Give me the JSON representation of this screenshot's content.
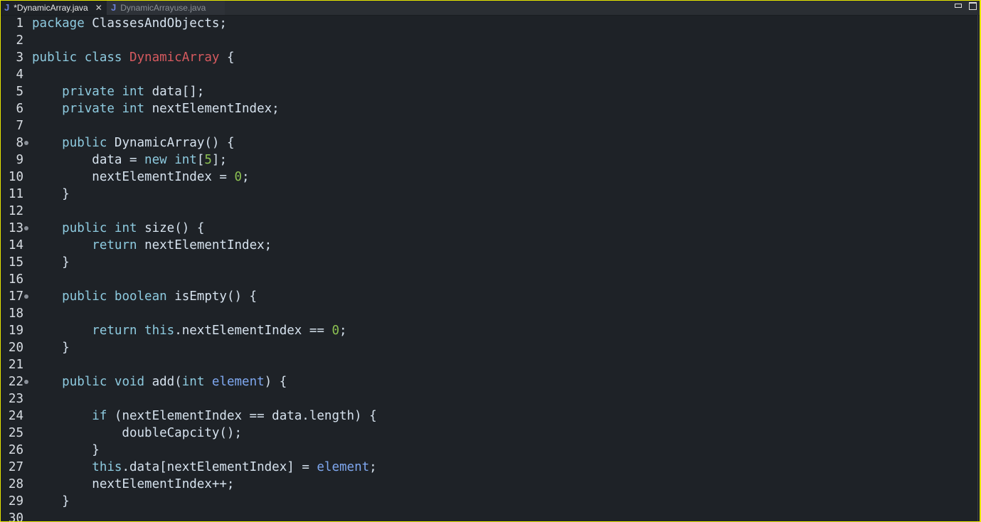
{
  "tabs": [
    {
      "label": "*DynamicArray.java",
      "icon": "java-file-icon",
      "active": true
    },
    {
      "label": "DynamicArrayuse.java",
      "icon": "java-file-icon",
      "active": false
    }
  ],
  "colors": {
    "keyword": "#8ecbe0",
    "class": "#d65a5f",
    "number": "#8cc152",
    "param": "#7fa8f0",
    "text": "#d6e2ee",
    "background": "#1e2227"
  },
  "lines": [
    {
      "n": "1",
      "seg": [
        [
          "kw",
          "package "
        ],
        [
          "plain",
          "ClassesAndObjects;"
        ]
      ]
    },
    {
      "n": "2",
      "seg": []
    },
    {
      "n": "3",
      "seg": [
        [
          "kw",
          "public class "
        ],
        [
          "cls",
          "DynamicArray"
        ],
        [
          "plain",
          " {"
        ]
      ]
    },
    {
      "n": "4",
      "seg": []
    },
    {
      "n": "5",
      "seg": [
        [
          "plain",
          "    "
        ],
        [
          "kw",
          "private int "
        ],
        [
          "plain",
          "data[];"
        ]
      ]
    },
    {
      "n": "6",
      "seg": [
        [
          "plain",
          "    "
        ],
        [
          "kw",
          "private int "
        ],
        [
          "plain",
          "nextElementIndex;"
        ]
      ]
    },
    {
      "n": "7",
      "seg": []
    },
    {
      "n": "8",
      "fold": true,
      "seg": [
        [
          "plain",
          "    "
        ],
        [
          "kw",
          "public "
        ],
        [
          "plain",
          "DynamicArray() {"
        ]
      ]
    },
    {
      "n": "9",
      "seg": [
        [
          "plain",
          "        data = "
        ],
        [
          "kw",
          "new int"
        ],
        [
          "plain",
          "["
        ],
        [
          "num",
          "5"
        ],
        [
          "plain",
          "];"
        ]
      ]
    },
    {
      "n": "10",
      "seg": [
        [
          "plain",
          "        nextElementIndex = "
        ],
        [
          "num",
          "0"
        ],
        [
          "plain",
          ";"
        ]
      ]
    },
    {
      "n": "11",
      "seg": [
        [
          "plain",
          "    }"
        ]
      ]
    },
    {
      "n": "12",
      "seg": []
    },
    {
      "n": "13",
      "fold": true,
      "seg": [
        [
          "plain",
          "    "
        ],
        [
          "kw",
          "public int "
        ],
        [
          "plain",
          "size() {"
        ]
      ]
    },
    {
      "n": "14",
      "seg": [
        [
          "plain",
          "        "
        ],
        [
          "kw",
          "return "
        ],
        [
          "plain",
          "nextElementIndex;"
        ]
      ]
    },
    {
      "n": "15",
      "seg": [
        [
          "plain",
          "    }"
        ]
      ]
    },
    {
      "n": "16",
      "seg": []
    },
    {
      "n": "17",
      "fold": true,
      "seg": [
        [
          "plain",
          "    "
        ],
        [
          "kw",
          "public boolean "
        ],
        [
          "plain",
          "isEmpty() {"
        ]
      ]
    },
    {
      "n": "18",
      "seg": []
    },
    {
      "n": "19",
      "seg": [
        [
          "plain",
          "        "
        ],
        [
          "kw",
          "return this"
        ],
        [
          "plain",
          ".nextElementIndex == "
        ],
        [
          "num",
          "0"
        ],
        [
          "plain",
          ";"
        ]
      ]
    },
    {
      "n": "20",
      "seg": [
        [
          "plain",
          "    }"
        ]
      ]
    },
    {
      "n": "21",
      "seg": []
    },
    {
      "n": "22",
      "fold": true,
      "seg": [
        [
          "plain",
          "    "
        ],
        [
          "kw",
          "public void "
        ],
        [
          "plain",
          "add("
        ],
        [
          "kw",
          "int "
        ],
        [
          "param",
          "element"
        ],
        [
          "plain",
          ") {"
        ]
      ]
    },
    {
      "n": "23",
      "seg": []
    },
    {
      "n": "24",
      "seg": [
        [
          "plain",
          "        "
        ],
        [
          "kw",
          "if "
        ],
        [
          "plain",
          "(nextElementIndex == data.length) {"
        ]
      ]
    },
    {
      "n": "25",
      "seg": [
        [
          "plain",
          "            doubleCapcity();"
        ]
      ]
    },
    {
      "n": "26",
      "seg": [
        [
          "plain",
          "        }"
        ]
      ]
    },
    {
      "n": "27",
      "seg": [
        [
          "plain",
          "        "
        ],
        [
          "kw",
          "this"
        ],
        [
          "plain",
          ".data[nextElementIndex] = "
        ],
        [
          "param",
          "element"
        ],
        [
          "plain",
          ";"
        ]
      ]
    },
    {
      "n": "28",
      "seg": [
        [
          "plain",
          "        nextElementIndex++;"
        ]
      ]
    },
    {
      "n": "29",
      "seg": [
        [
          "plain",
          "    }"
        ]
      ]
    },
    {
      "n": "30",
      "seg": []
    }
  ]
}
